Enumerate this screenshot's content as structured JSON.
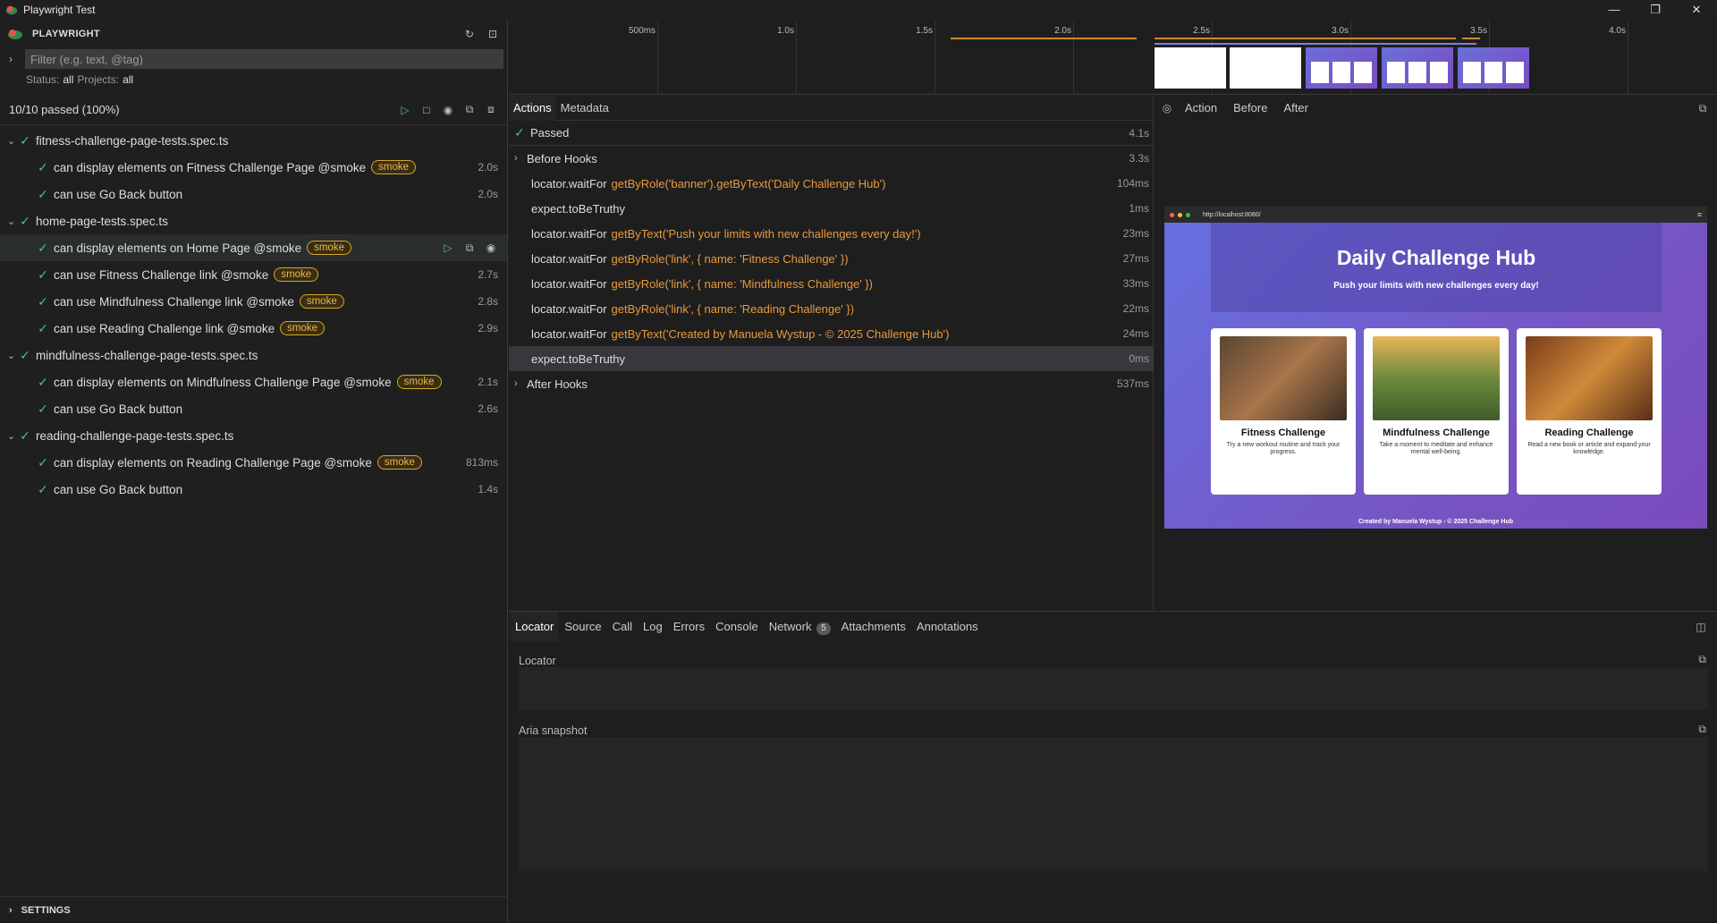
{
  "window": {
    "title": "Playwright Test",
    "minimize": "—",
    "maximize": "❐",
    "close": "✕"
  },
  "sidebar": {
    "brand": "PLAYWRIGHT",
    "filter_placeholder": "Filter (e.g. text, @tag)",
    "status_label": "Status:",
    "status_value": "all",
    "projects_label": "Projects:",
    "projects_value": "all",
    "passed_summary": "10/10 passed (100%)",
    "settings_label": "SETTINGS",
    "files": [
      {
        "name": "fitness-challenge-page-tests.spec.ts",
        "tests": [
          {
            "name": "can display elements on Fitness Challenge Page @smoke",
            "tag": "smoke",
            "duration": "2.0s"
          },
          {
            "name": "can use Go Back button",
            "tag": "",
            "duration": "2.0s"
          }
        ]
      },
      {
        "name": "home-page-tests.spec.ts",
        "tests": [
          {
            "name": "can display elements on Home Page @smoke",
            "tag": "smoke",
            "duration": ""
          },
          {
            "name": "can use Fitness Challenge link @smoke",
            "tag": "smoke",
            "duration": "2.7s"
          },
          {
            "name": "can use Mindfulness Challenge link @smoke",
            "tag": "smoke",
            "duration": "2.8s"
          },
          {
            "name": "can use Reading Challenge link @smoke",
            "tag": "smoke",
            "duration": "2.9s"
          }
        ]
      },
      {
        "name": "mindfulness-challenge-page-tests.spec.ts",
        "tests": [
          {
            "name": "can display elements on Mindfulness Challenge Page @smoke",
            "tag": "smoke",
            "duration": "2.1s"
          },
          {
            "name": "can use Go Back button",
            "tag": "",
            "duration": "2.6s"
          }
        ]
      },
      {
        "name": "reading-challenge-page-tests.spec.ts",
        "tests": [
          {
            "name": "can display elements on Reading Challenge Page @smoke",
            "tag": "smoke",
            "duration": "813ms"
          },
          {
            "name": "can use Go Back button",
            "tag": "",
            "duration": "1.4s"
          }
        ]
      }
    ]
  },
  "timeline": {
    "ticks": [
      "500ms",
      "1.0s",
      "1.5s",
      "2.0s",
      "2.5s",
      "3.0s",
      "3.5s",
      "4.0s"
    ]
  },
  "actions": {
    "tabs": [
      "Actions",
      "Metadata"
    ],
    "status": "Passed",
    "status_time": "4.1s",
    "before_hooks": "Before Hooks",
    "before_time": "3.3s",
    "after_hooks": "After Hooks",
    "after_time": "537ms",
    "rows": [
      {
        "method": "locator.waitFor",
        "selector": "getByRole('banner').getByText('Daily Challenge Hub')",
        "time": "104ms"
      },
      {
        "method": "expect.toBeTruthy",
        "selector": "",
        "time": "1ms"
      },
      {
        "method": "locator.waitFor",
        "selector": "getByText('Push your limits with new challenges every day!')",
        "time": "23ms"
      },
      {
        "method": "locator.waitFor",
        "selector": "getByRole('link', { name: 'Fitness Challenge' })",
        "time": "27ms"
      },
      {
        "method": "locator.waitFor",
        "selector": "getByRole('link', { name: 'Mindfulness Challenge' })",
        "time": "33ms"
      },
      {
        "method": "locator.waitFor",
        "selector": "getByRole('link', { name: 'Reading Challenge' })",
        "time": "22ms"
      },
      {
        "method": "locator.waitFor",
        "selector": "getByText('Created by Manuela Wystup - © 2025 Challenge Hub')",
        "time": "24ms"
      },
      {
        "method": "expect.toBeTruthy",
        "selector": "",
        "time": "0ms"
      }
    ]
  },
  "snapshot": {
    "tabs": [
      "Action",
      "Before",
      "After"
    ],
    "url": "http://localhost:8080/",
    "title": "Daily Challenge Hub",
    "subtitle": "Push your limits with new challenges every day!",
    "cards": [
      {
        "title": "Fitness Challenge",
        "text": "Try a new workout routine and track your progress."
      },
      {
        "title": "Mindfulness Challenge",
        "text": "Take a moment to meditate and enhance mental well-being."
      },
      {
        "title": "Reading Challenge",
        "text": "Read a new book or article and expand your knowledge."
      }
    ],
    "footer": "Created by Manuela Wystup - © 2025 Challenge Hub"
  },
  "bottom": {
    "tabs": [
      "Locator",
      "Source",
      "Call",
      "Log",
      "Errors",
      "Console",
      "Network",
      "Attachments",
      "Annotations"
    ],
    "network_count": "5",
    "locator_label": "Locator",
    "aria_label": "Aria snapshot"
  },
  "colors": {
    "pass": "#4ec27a",
    "tag": "#d6a52b",
    "selector": "#e99a3c"
  }
}
